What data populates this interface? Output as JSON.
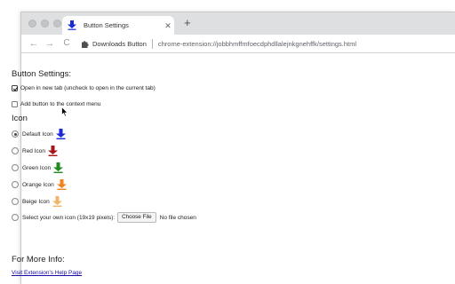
{
  "browser": {
    "tab_title": "Button Settings",
    "tab_close": "✕",
    "new_tab": "+",
    "nav": {
      "back": "←",
      "forward": "→",
      "reload": "C"
    },
    "omnibox": {
      "extension_name": "Downloads Button",
      "url": "chrome-extension://jobbhmffmfoecdphdllalejnkgnehffk/settings.html"
    }
  },
  "page": {
    "settings_heading": "Button Settings:",
    "open_in_new_tab": {
      "label": "Open in new tab (uncheck to open in the current tab)",
      "checked": true
    },
    "context_menu": {
      "label": "Add button to the context menu",
      "checked": false
    },
    "icon_heading": "Icon",
    "icon_options": [
      {
        "label": "Default Icon",
        "selected": true,
        "color": "#1a2bd6"
      },
      {
        "label": "Red Icon",
        "selected": false,
        "color": "#a4161a"
      },
      {
        "label": "Green Icon",
        "selected": false,
        "color": "#1f8a1f"
      },
      {
        "label": "Orange Icon",
        "selected": false,
        "color": "#f0841c"
      },
      {
        "label": "Beige Icon",
        "selected": false,
        "color": "#f1b46a"
      }
    ],
    "custom_icon": {
      "label": "Select your own icon (19x19 pixels):",
      "button": "Choose File",
      "status": "No file chosen"
    },
    "more_info_heading": "For More Info:",
    "help_link": "Visit Extension's Help Page"
  }
}
